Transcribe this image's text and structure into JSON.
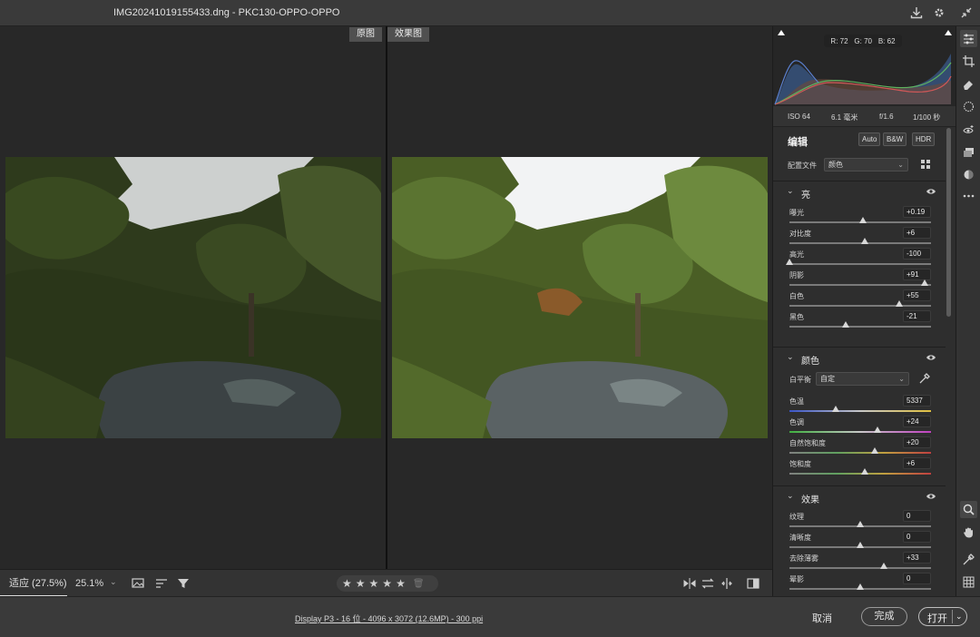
{
  "window": {
    "title": "IMG20241019155433.dng -  PKC130-OPPO-OPPO"
  },
  "views": {
    "before_label": "原图",
    "after_label": "效果图"
  },
  "bottom_toolbar": {
    "zoom_fit": "适应 (27.5%)",
    "zoom_percent": "25.1%",
    "rating_stars": 5
  },
  "status": {
    "display_info": "Display P3 - 16 位 - 4096 x 3072 (12.6MP) - 300 ppi",
    "cancel_label": "取消",
    "done_label": "完成",
    "open_label": "打开"
  },
  "histogram": {
    "r": "R: 72",
    "g": "G: 70",
    "b": "B: 62"
  },
  "exif": {
    "iso": "ISO 64",
    "focal": "6.1 毫米",
    "aperture": "f/1.6",
    "shutter": "1/100 秒"
  },
  "edit": {
    "title": "编辑",
    "auto_label": "Auto",
    "bw_label": "B&W",
    "hdr_label": "HDR",
    "profile_label": "配置文件",
    "profile_value": "颜色"
  },
  "sections": {
    "light": {
      "name": "亮",
      "sliders": [
        {
          "name": "曝光",
          "value": "+0.19",
          "pos": 0.52
        },
        {
          "name": "对比度",
          "value": "+6",
          "pos": 0.53
        },
        {
          "name": "高光",
          "value": "-100",
          "pos": 0.0
        },
        {
          "name": "阴影",
          "value": "+91",
          "pos": 0.955
        },
        {
          "name": "白色",
          "value": "+55",
          "pos": 0.775
        },
        {
          "name": "黑色",
          "value": "-21",
          "pos": 0.395
        }
      ]
    },
    "color": {
      "name": "颜色",
      "wb_label": "白平衡",
      "wb_value": "自定",
      "sliders": [
        {
          "name": "色温",
          "value": "5337",
          "pos": 0.33
        },
        {
          "name": "色调",
          "value": "+24",
          "pos": 0.62
        },
        {
          "name": "自然饱和度",
          "value": "+20",
          "pos": 0.6
        },
        {
          "name": "饱和度",
          "value": "+6",
          "pos": 0.53
        }
      ]
    },
    "effects": {
      "name": "效果",
      "sliders": [
        {
          "name": "纹理",
          "value": "0",
          "pos": 0.5
        },
        {
          "name": "清晰度",
          "value": "0",
          "pos": 0.5
        },
        {
          "name": "去除薄雾",
          "value": "+33",
          "pos": 0.665
        },
        {
          "name": "晕影",
          "value": "0",
          "pos": 0.5
        }
      ]
    }
  },
  "colors": {
    "panel_bg": "#2e2e2e",
    "canvas_bg": "#282828",
    "accent_text": "#e8e8e8"
  }
}
